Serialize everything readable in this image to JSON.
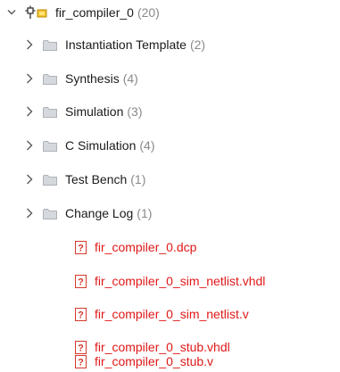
{
  "tree": {
    "root": {
      "label": "fir_compiler_0",
      "count": "(20)",
      "icon": "ip-core-icon"
    },
    "folders": [
      {
        "label": "Instantiation Template",
        "count": "(2)"
      },
      {
        "label": "Synthesis",
        "count": "(4)"
      },
      {
        "label": "Simulation",
        "count": "(3)"
      },
      {
        "label": "C Simulation",
        "count": "(4)"
      },
      {
        "label": "Test Bench",
        "count": "(1)"
      },
      {
        "label": "Change Log",
        "count": "(1)"
      }
    ],
    "files": [
      {
        "label": "fir_compiler_0.dcp"
      },
      {
        "label": "fir_compiler_0_sim_netlist.vhdl"
      },
      {
        "label": "fir_compiler_0_sim_netlist.v"
      },
      {
        "label": "fir_compiler_0_stub.vhdl"
      },
      {
        "label": "fir_compiler_0_stub.v"
      }
    ]
  },
  "colors": {
    "missing_file": "#e01818",
    "count_text": "#8a8a8a",
    "folder_icon": "#c9cdd2",
    "chevron": "#5a5a5a",
    "unknown_file_icon": "#d4392b"
  }
}
